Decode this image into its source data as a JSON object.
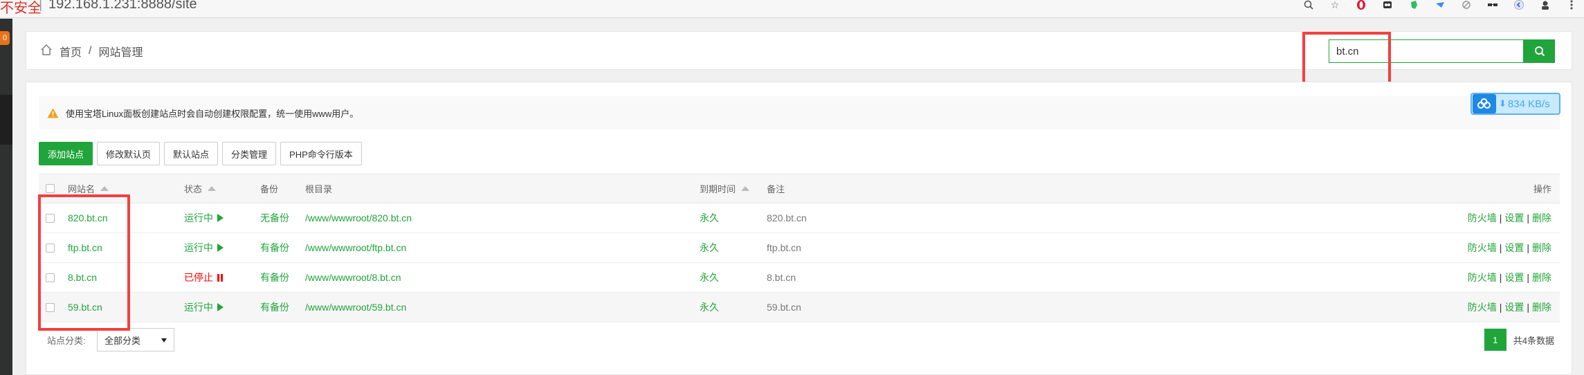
{
  "browser": {
    "insecure": "不安全",
    "separator": "|",
    "url": "192.168.1.231:8888/site",
    "icons": [
      "zoom-icon",
      "star-icon",
      "opera-icon",
      "extension-icon",
      "evernote-icon",
      "extension-icon",
      "extension-icon",
      "glasses-icon",
      "profile-icon",
      "avatar-icon",
      "menu-icon"
    ]
  },
  "sidebar": {
    "badge": "0"
  },
  "breadcrumb": {
    "home": "首页",
    "separator": "/",
    "current": "网站管理"
  },
  "search": {
    "value": "bt.cn"
  },
  "notice": {
    "text": "使用宝塔Linux面板创建站点时会自动创建权限配置，统一使用www用户。"
  },
  "speed": {
    "value": "834 KB/s"
  },
  "toolbar": {
    "add_site": "添加站点",
    "edit_default_page": "修改默认页",
    "default_site": "默认站点",
    "category_manage": "分类管理",
    "php_cli_version": "PHP命令行版本"
  },
  "table": {
    "headers": {
      "name": "网站名",
      "status": "状态",
      "backup": "备份",
      "root": "根目录",
      "expire": "到期时间",
      "remark": "备注",
      "actions": "操作"
    },
    "rows": [
      {
        "name": "820.bt.cn",
        "status": "运行中",
        "running": true,
        "backup": "无备份",
        "root": "/www/wwwroot/820.bt.cn",
        "expire": "永久",
        "remark": "820.bt.cn"
      },
      {
        "name": "ftp.bt.cn",
        "status": "运行中",
        "running": true,
        "backup": "有备份",
        "root": "/www/wwwroot/ftp.bt.cn",
        "expire": "永久",
        "remark": "ftp.bt.cn"
      },
      {
        "name": "8.bt.cn",
        "status": "已停止",
        "running": false,
        "backup": "有备份",
        "root": "/www/wwwroot/8.bt.cn",
        "expire": "永久",
        "remark": "8.bt.cn"
      },
      {
        "name": "59.bt.cn",
        "status": "运行中",
        "running": true,
        "backup": "有备份",
        "root": "/www/wwwroot/59.bt.cn",
        "expire": "永久",
        "remark": "59.bt.cn"
      }
    ],
    "row_actions": {
      "firewall": "防火墙",
      "settings": "设置",
      "delete": "删除",
      "sep": "|"
    }
  },
  "footer": {
    "category_label": "站点分类:",
    "category_value": "全部分类",
    "page": "1",
    "total": "共4条数据"
  },
  "colors": {
    "accent": "#20a53a",
    "stopped": "#ff0000",
    "highlight": "#f43f3f"
  }
}
